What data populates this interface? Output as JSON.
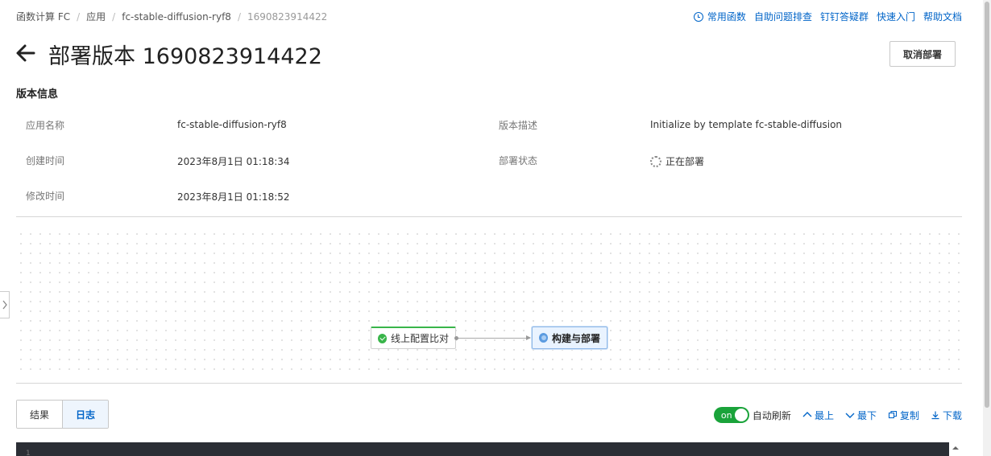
{
  "breadcrumb": {
    "items": [
      "函数计算 FC",
      "应用",
      "fc-stable-diffusion-ryf8"
    ],
    "current": "1690823914422",
    "separator": "/"
  },
  "top_links": {
    "common_functions": "常用函数",
    "self_troubleshoot": "自助问题排查",
    "dingtalk_group": "钉钉答疑群",
    "quick_start": "快速入门",
    "help_docs": "帮助文档"
  },
  "header": {
    "title": "部署版本 1690823914422",
    "cancel_label": "取消部署"
  },
  "version_info": {
    "section_title": "版本信息",
    "app_name_label": "应用名称",
    "app_name": "fc-stable-diffusion-ryf8",
    "desc_label": "版本描述",
    "desc": "Initialize by template fc-stable-diffusion",
    "created_label": "创建时间",
    "created": "2023年8月1日 01:18:34",
    "status_label": "部署状态",
    "status": "正在部署",
    "modified_label": "修改时间",
    "modified": "2023年8月1日 01:18:52"
  },
  "pipeline": {
    "nodes": [
      {
        "label": "线上配置比对",
        "state": "success"
      },
      {
        "label": "构建与部署",
        "state": "running"
      }
    ]
  },
  "log_panel": {
    "tabs": [
      "结果",
      "日志"
    ],
    "active_tab": "日志",
    "toggle_label": "on",
    "auto_refresh_label": "自动刷新",
    "auto_refresh_on": true,
    "top_label": "最上",
    "bottom_label": "最下",
    "copy_label": "复制",
    "download_label": "下载",
    "first_line_number": "1"
  },
  "colors": {
    "link": "#0064c8",
    "success": "#39b54a",
    "toggle_on": "#1aa33a",
    "log_bg": "#2b2e35"
  }
}
